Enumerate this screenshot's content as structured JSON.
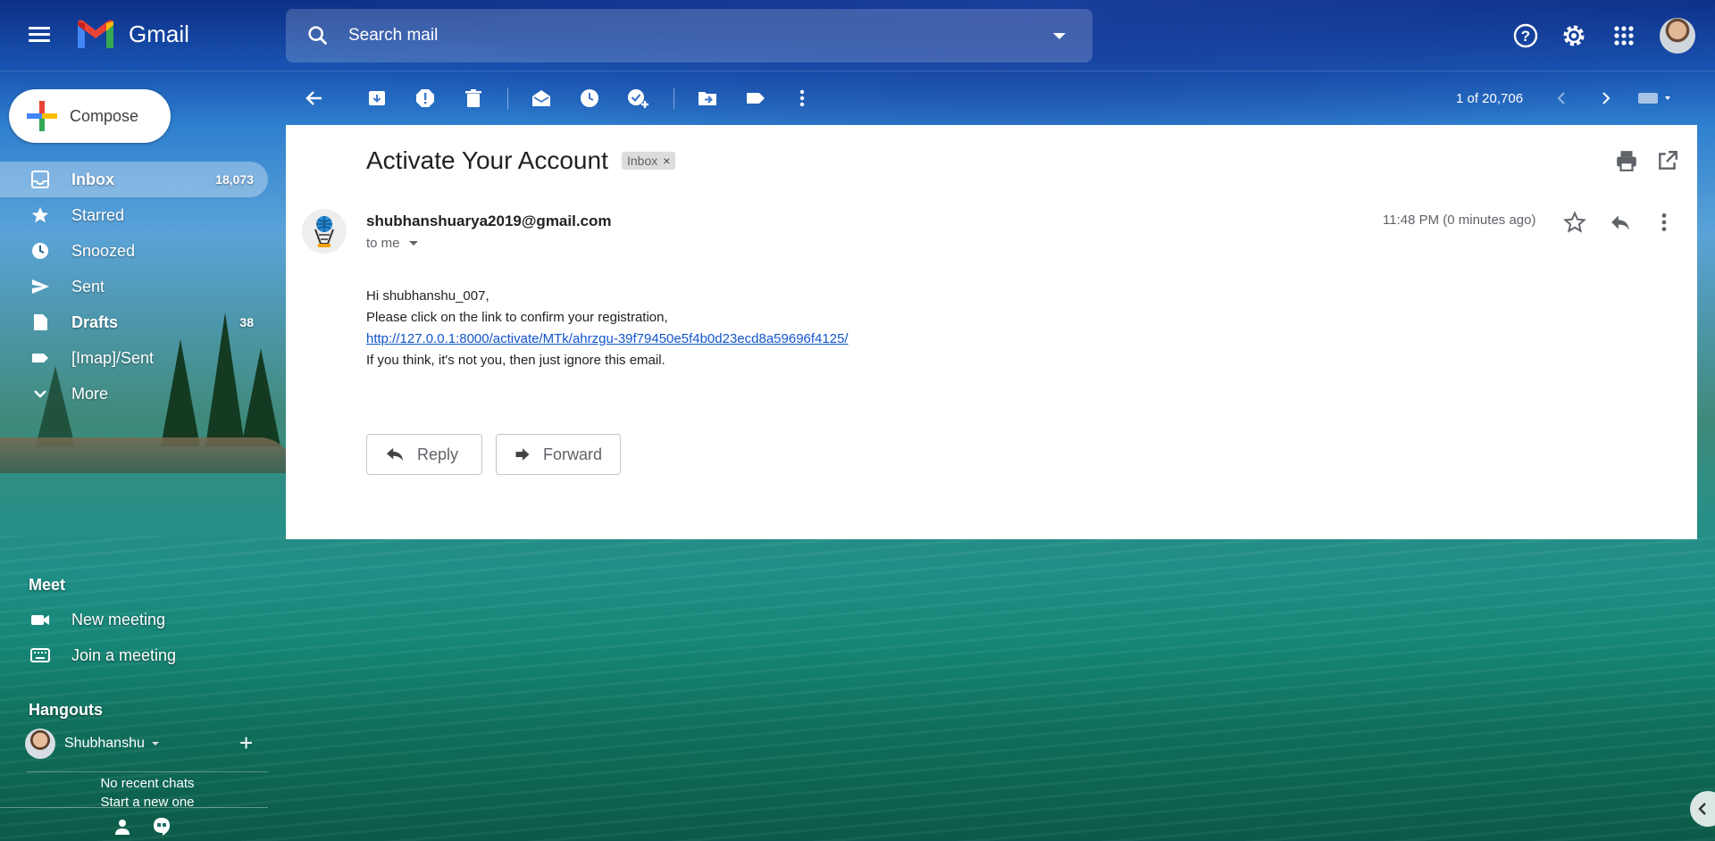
{
  "header": {
    "app_name": "Gmail",
    "search_placeholder": "Search mail"
  },
  "sidebar": {
    "compose_label": "Compose",
    "items": [
      {
        "label": "Inbox",
        "count": "18,073",
        "icon": "inbox-icon"
      },
      {
        "label": "Starred",
        "count": "",
        "icon": "star-icon"
      },
      {
        "label": "Snoozed",
        "count": "",
        "icon": "clock-icon"
      },
      {
        "label": "Sent",
        "count": "",
        "icon": "send-icon"
      },
      {
        "label": "Drafts",
        "count": "38",
        "icon": "draft-icon"
      },
      {
        "label": "[Imap]/Sent",
        "count": "",
        "icon": "label-icon"
      },
      {
        "label": "More",
        "count": "",
        "icon": "chevron-down-icon"
      }
    ],
    "meet": {
      "title": "Meet",
      "new_meeting": "New meeting",
      "join_meeting": "Join a meeting"
    },
    "hangouts": {
      "title": "Hangouts",
      "user": "Shubhanshu",
      "no_recent": "No recent chats",
      "start_new": "Start a new one"
    }
  },
  "toolbar": {
    "pager": "1 of 20,706"
  },
  "message": {
    "subject": "Activate Your Account",
    "label": "Inbox",
    "label_close": "×",
    "sender": "shubhanshuarya2019@gmail.com",
    "to": "to me",
    "time": "11:48 PM (0 minutes ago)",
    "body": {
      "greeting": "Hi shubhanshu_007,",
      "line1": "Please click on the link to confirm your registration,",
      "link": "http://127.0.0.1:8000/activate/MTk/ahrzgu-39f79450e5f4b0d23ecd8a59696f4125/",
      "line2": "If you think, it's not you, then just ignore this email."
    },
    "reply_label": "Reply",
    "forward_label": "Forward"
  },
  "colors": {
    "accent": "#1a73e8",
    "link": "#1155cc",
    "active_nav_bg": "rgba(255,255,255,0.32)"
  }
}
